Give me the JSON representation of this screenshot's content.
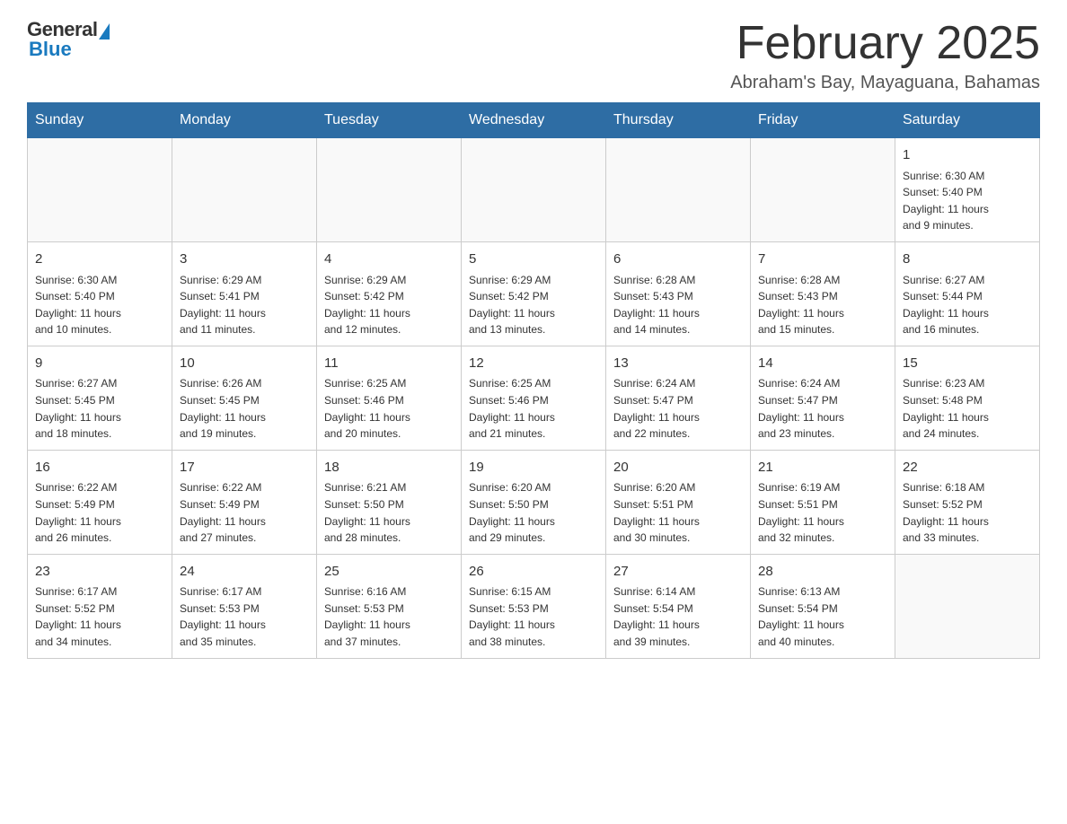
{
  "header": {
    "logo": {
      "general": "General",
      "blue": "Blue"
    },
    "title": "February 2025",
    "subtitle": "Abraham's Bay, Mayaguana, Bahamas"
  },
  "days_of_week": [
    "Sunday",
    "Monday",
    "Tuesday",
    "Wednesday",
    "Thursday",
    "Friday",
    "Saturday"
  ],
  "weeks": [
    {
      "days": [
        {
          "num": "",
          "info": ""
        },
        {
          "num": "",
          "info": ""
        },
        {
          "num": "",
          "info": ""
        },
        {
          "num": "",
          "info": ""
        },
        {
          "num": "",
          "info": ""
        },
        {
          "num": "",
          "info": ""
        },
        {
          "num": "1",
          "info": "Sunrise: 6:30 AM\nSunset: 5:40 PM\nDaylight: 11 hours\nand 9 minutes."
        }
      ]
    },
    {
      "days": [
        {
          "num": "2",
          "info": "Sunrise: 6:30 AM\nSunset: 5:40 PM\nDaylight: 11 hours\nand 10 minutes."
        },
        {
          "num": "3",
          "info": "Sunrise: 6:29 AM\nSunset: 5:41 PM\nDaylight: 11 hours\nand 11 minutes."
        },
        {
          "num": "4",
          "info": "Sunrise: 6:29 AM\nSunset: 5:42 PM\nDaylight: 11 hours\nand 12 minutes."
        },
        {
          "num": "5",
          "info": "Sunrise: 6:29 AM\nSunset: 5:42 PM\nDaylight: 11 hours\nand 13 minutes."
        },
        {
          "num": "6",
          "info": "Sunrise: 6:28 AM\nSunset: 5:43 PM\nDaylight: 11 hours\nand 14 minutes."
        },
        {
          "num": "7",
          "info": "Sunrise: 6:28 AM\nSunset: 5:43 PM\nDaylight: 11 hours\nand 15 minutes."
        },
        {
          "num": "8",
          "info": "Sunrise: 6:27 AM\nSunset: 5:44 PM\nDaylight: 11 hours\nand 16 minutes."
        }
      ]
    },
    {
      "days": [
        {
          "num": "9",
          "info": "Sunrise: 6:27 AM\nSunset: 5:45 PM\nDaylight: 11 hours\nand 18 minutes."
        },
        {
          "num": "10",
          "info": "Sunrise: 6:26 AM\nSunset: 5:45 PM\nDaylight: 11 hours\nand 19 minutes."
        },
        {
          "num": "11",
          "info": "Sunrise: 6:25 AM\nSunset: 5:46 PM\nDaylight: 11 hours\nand 20 minutes."
        },
        {
          "num": "12",
          "info": "Sunrise: 6:25 AM\nSunset: 5:46 PM\nDaylight: 11 hours\nand 21 minutes."
        },
        {
          "num": "13",
          "info": "Sunrise: 6:24 AM\nSunset: 5:47 PM\nDaylight: 11 hours\nand 22 minutes."
        },
        {
          "num": "14",
          "info": "Sunrise: 6:24 AM\nSunset: 5:47 PM\nDaylight: 11 hours\nand 23 minutes."
        },
        {
          "num": "15",
          "info": "Sunrise: 6:23 AM\nSunset: 5:48 PM\nDaylight: 11 hours\nand 24 minutes."
        }
      ]
    },
    {
      "days": [
        {
          "num": "16",
          "info": "Sunrise: 6:22 AM\nSunset: 5:49 PM\nDaylight: 11 hours\nand 26 minutes."
        },
        {
          "num": "17",
          "info": "Sunrise: 6:22 AM\nSunset: 5:49 PM\nDaylight: 11 hours\nand 27 minutes."
        },
        {
          "num": "18",
          "info": "Sunrise: 6:21 AM\nSunset: 5:50 PM\nDaylight: 11 hours\nand 28 minutes."
        },
        {
          "num": "19",
          "info": "Sunrise: 6:20 AM\nSunset: 5:50 PM\nDaylight: 11 hours\nand 29 minutes."
        },
        {
          "num": "20",
          "info": "Sunrise: 6:20 AM\nSunset: 5:51 PM\nDaylight: 11 hours\nand 30 minutes."
        },
        {
          "num": "21",
          "info": "Sunrise: 6:19 AM\nSunset: 5:51 PM\nDaylight: 11 hours\nand 32 minutes."
        },
        {
          "num": "22",
          "info": "Sunrise: 6:18 AM\nSunset: 5:52 PM\nDaylight: 11 hours\nand 33 minutes."
        }
      ]
    },
    {
      "days": [
        {
          "num": "23",
          "info": "Sunrise: 6:17 AM\nSunset: 5:52 PM\nDaylight: 11 hours\nand 34 minutes."
        },
        {
          "num": "24",
          "info": "Sunrise: 6:17 AM\nSunset: 5:53 PM\nDaylight: 11 hours\nand 35 minutes."
        },
        {
          "num": "25",
          "info": "Sunrise: 6:16 AM\nSunset: 5:53 PM\nDaylight: 11 hours\nand 37 minutes."
        },
        {
          "num": "26",
          "info": "Sunrise: 6:15 AM\nSunset: 5:53 PM\nDaylight: 11 hours\nand 38 minutes."
        },
        {
          "num": "27",
          "info": "Sunrise: 6:14 AM\nSunset: 5:54 PM\nDaylight: 11 hours\nand 39 minutes."
        },
        {
          "num": "28",
          "info": "Sunrise: 6:13 AM\nSunset: 5:54 PM\nDaylight: 11 hours\nand 40 minutes."
        },
        {
          "num": "",
          "info": ""
        }
      ]
    }
  ]
}
